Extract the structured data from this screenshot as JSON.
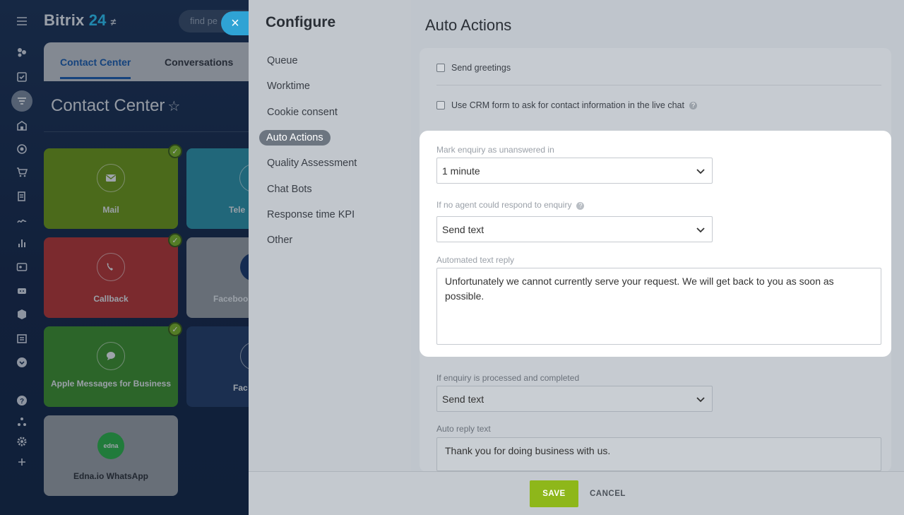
{
  "app": {
    "brand": "Bitrix",
    "brand_num": "24",
    "search_placeholder": "find pe",
    "tabs": [
      "Contact Center",
      "Conversations"
    ],
    "page_title": "Contact Center",
    "tiles": [
      {
        "label": "Mail",
        "color": "#6f9a19",
        "checked": true,
        "icon": "mail-icon"
      },
      {
        "label": "Tele",
        "color": "#2f96ab",
        "checked": false,
        "icon": "phone-icon"
      },
      {
        "label": "Callback",
        "color": "#b83837",
        "checked": true,
        "icon": "callback-icon"
      },
      {
        "label": "Faceboo",
        "color": "#9aa0a7",
        "checked": false,
        "icon": "facebook-icon"
      },
      {
        "label": "Apple Messages for Business",
        "color": "#40922f",
        "checked": true,
        "icon": "chat-bubble-icon"
      },
      {
        "label": "Fac",
        "color": "#26406a",
        "checked": false,
        "icon": "facebook-icon"
      },
      {
        "label": "Edna.io WhatsApp",
        "color": "#9ca1a8",
        "checked": false,
        "icon": "edna-logo-icon",
        "logo_text": "edna"
      }
    ]
  },
  "panel": {
    "nav_title": "Configure",
    "nav_items": [
      "Queue",
      "Worktime",
      "Cookie consent",
      "Auto Actions",
      "Quality Assessment",
      "Chat Bots",
      "Response time KPI",
      "Other"
    ],
    "active_index": 3,
    "main_title": "Auto Actions",
    "checkbox_greetings": "Send greetings",
    "checkbox_crm_form": "Use CRM form to ask for contact information in the live chat",
    "mark_unanswered_label": "Mark enquiry as unanswered in",
    "mark_unanswered_value": "1 minute",
    "no_agent_label": "If no agent could respond to enquiry",
    "no_agent_value": "Send text",
    "auto_text_label": "Automated text reply",
    "auto_text_value": "Unfortunately we cannot currently serve your request. We will get back to you as soon as possible.",
    "completed_label": "If enquiry is processed and completed",
    "completed_value": "Send text",
    "auto_reply_label": "Auto reply text",
    "auto_reply_value": "Thank you for doing business with us.",
    "save_label": "SAVE",
    "cancel_label": "CANCEL"
  }
}
